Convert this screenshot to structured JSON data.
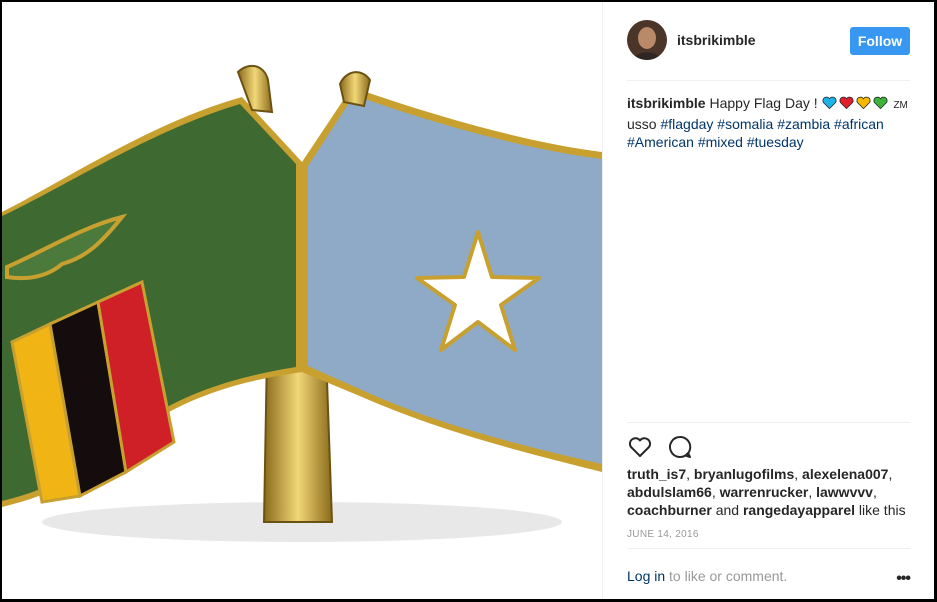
{
  "post": {
    "username": "itsbrikimble",
    "follow_label": "Follow",
    "caption_user": "itsbrikimble",
    "caption_text": "Happy Flag Day !",
    "caption_zm": "ZM",
    "caption_word": "usso",
    "hashtags": [
      "#flagday",
      "#somalia",
      "#zambia",
      "#african",
      "#American",
      "#mixed",
      "#tuesday"
    ],
    "emoji_colors": [
      "#1eb3e6",
      "#e0202a",
      "#f5b800",
      "#3cb43c"
    ],
    "likes_users": [
      "truth_is7",
      "bryanlugofilms",
      "alexelena007",
      "abdulslam66",
      "warrenrucker",
      "lawwvvv",
      "coachburner"
    ],
    "likes_and": "and",
    "likes_last": "rangedayapparel",
    "likes_suffix": "like this",
    "date": "JUNE 14, 2016",
    "login_link": "Log in",
    "login_text": "to like or comment.",
    "more_label": "•••",
    "icons": [
      "heart-icon",
      "comment-icon",
      "more-options-icon"
    ]
  },
  "flags": {
    "zambia_green": "#3e6a32",
    "somalia_blue": "#8eaac6",
    "stripe_red": "#cf2027",
    "stripe_black": "#150d0d",
    "stripe_orange": "#f0b515",
    "gold": "#c8a030"
  }
}
